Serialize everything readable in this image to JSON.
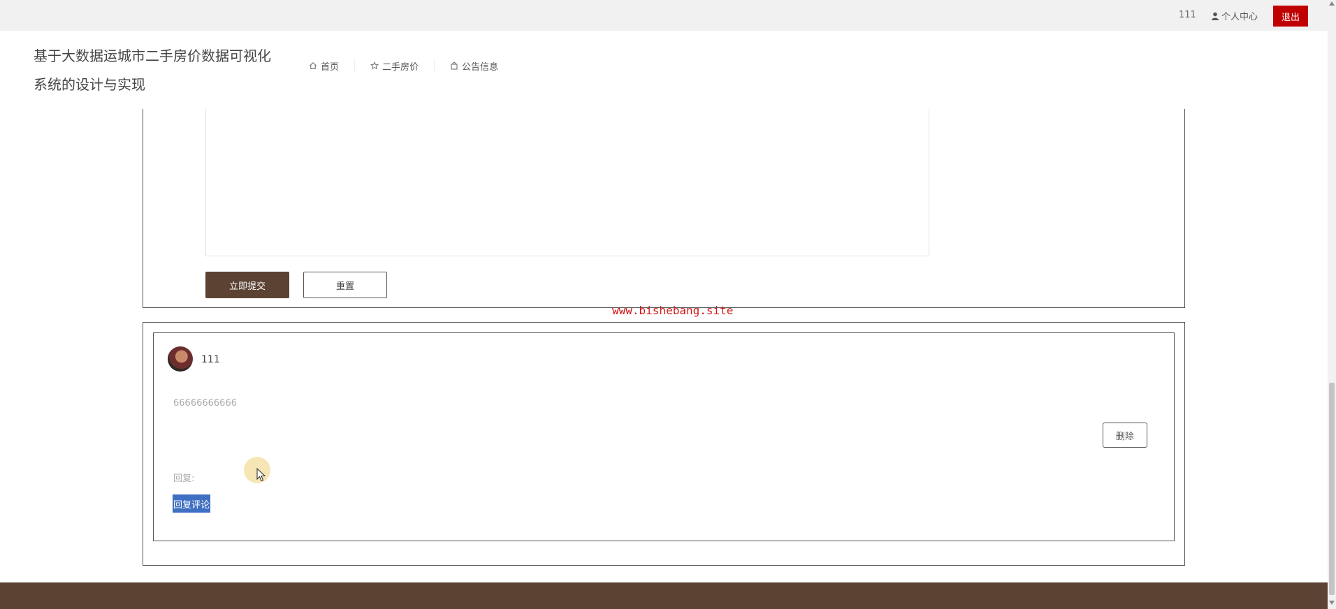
{
  "topbar": {
    "username": "111",
    "personal_center": "个人中心",
    "logout": "退出"
  },
  "header": {
    "site_title": "基于大数据运城市二手房价数据可视化系统的设计与实现",
    "nav": [
      {
        "label": "首页",
        "icon": "home-icon"
      },
      {
        "label": "二手房价",
        "icon": "star-icon"
      },
      {
        "label": "公告信息",
        "icon": "bag-icon"
      }
    ]
  },
  "form": {
    "submit_label": "立即提交",
    "reset_label": "重置"
  },
  "watermark": "www.bishebang.site",
  "comment": {
    "username": "111",
    "text": "66666666666",
    "delete_label": "删除",
    "reply_label": "回复:",
    "reply_link": "回复评论"
  },
  "colors": {
    "brand_brown": "#5b4232",
    "logout_red": "#c00000",
    "reply_blue": "#3f6fc2"
  }
}
